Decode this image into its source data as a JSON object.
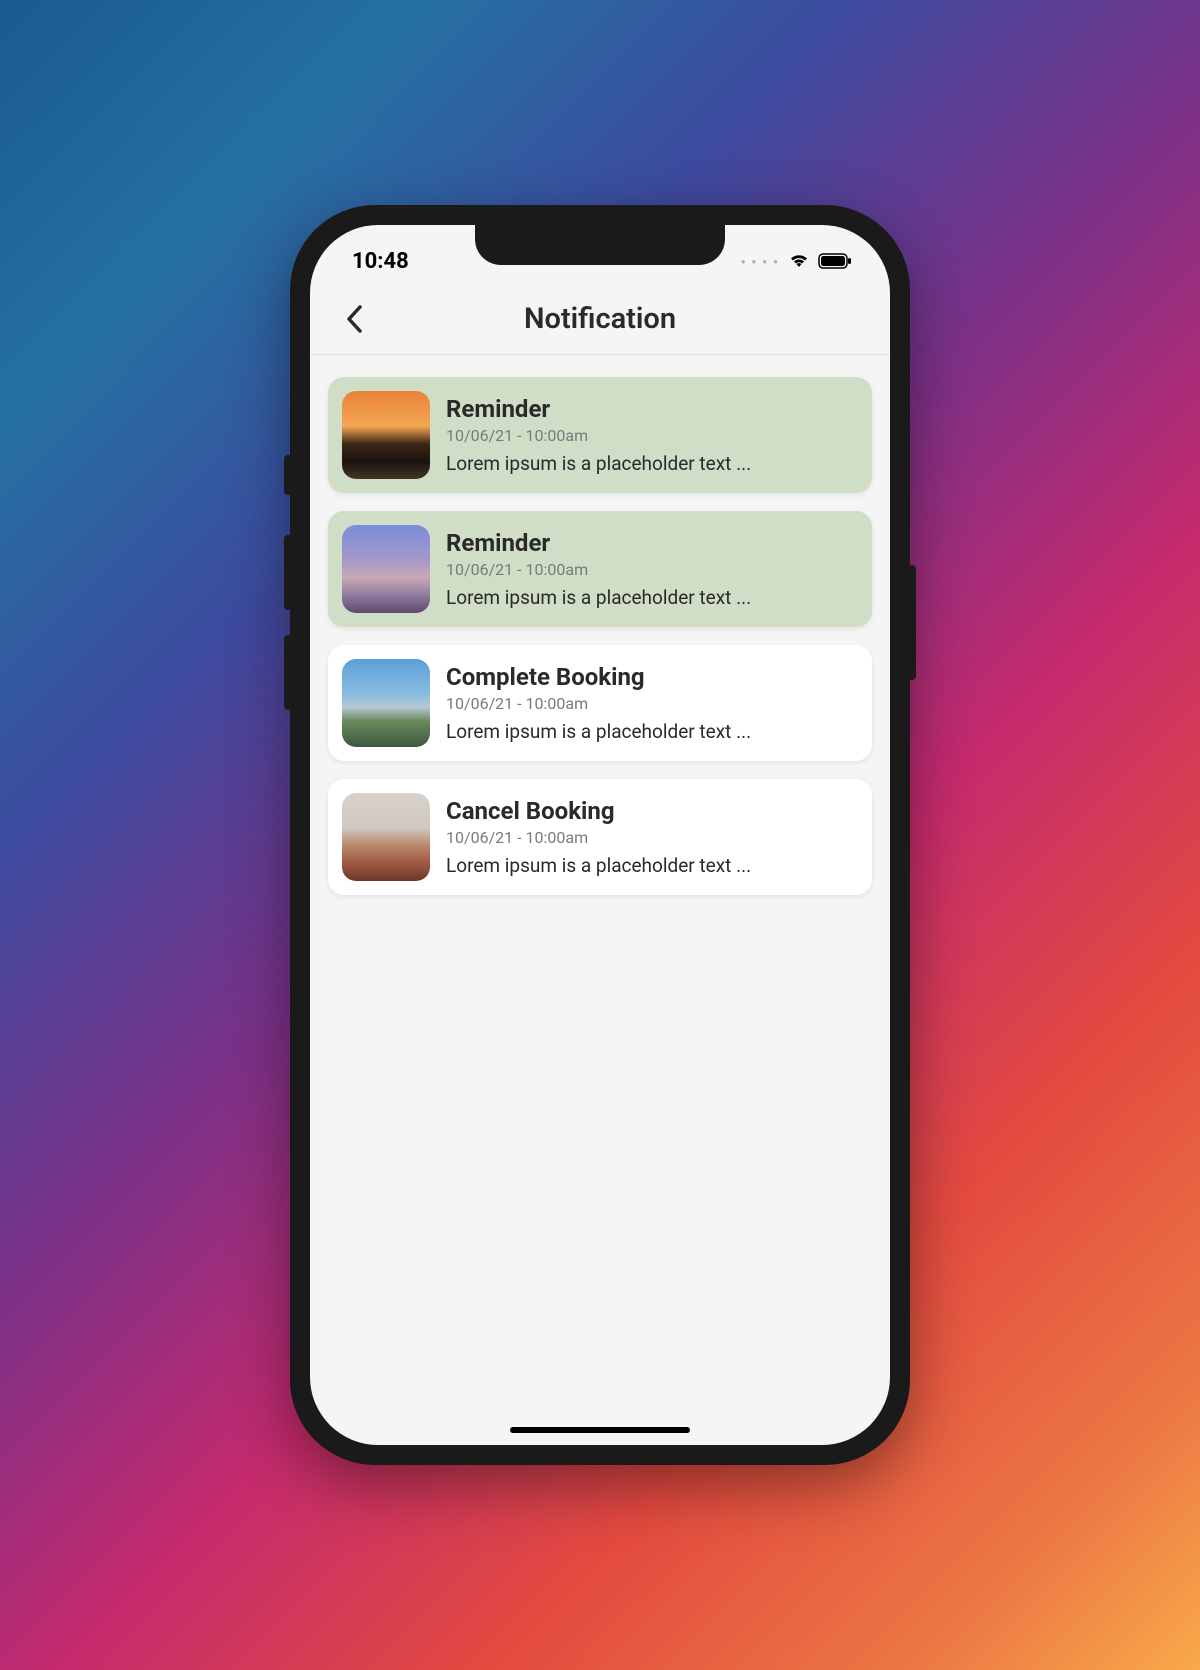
{
  "status": {
    "time": "10:48"
  },
  "header": {
    "title": "Notification"
  },
  "notifications": [
    {
      "title": "Reminder",
      "datetime": "10/06/21 - 10:00am",
      "body": "Lorem ipsum is a placeholder text ...",
      "unread": true
    },
    {
      "title": "Reminder",
      "datetime": "10/06/21 - 10:00am",
      "body": "Lorem ipsum is a placeholder text ...",
      "unread": true
    },
    {
      "title": "Complete Booking",
      "datetime": "10/06/21 - 10:00am",
      "body": "Lorem ipsum is a placeholder text ...",
      "unread": false
    },
    {
      "title": "Cancel Booking",
      "datetime": "10/06/21 - 10:00am",
      "body": "Lorem ipsum is a placeholder text ...",
      "unread": false
    }
  ]
}
